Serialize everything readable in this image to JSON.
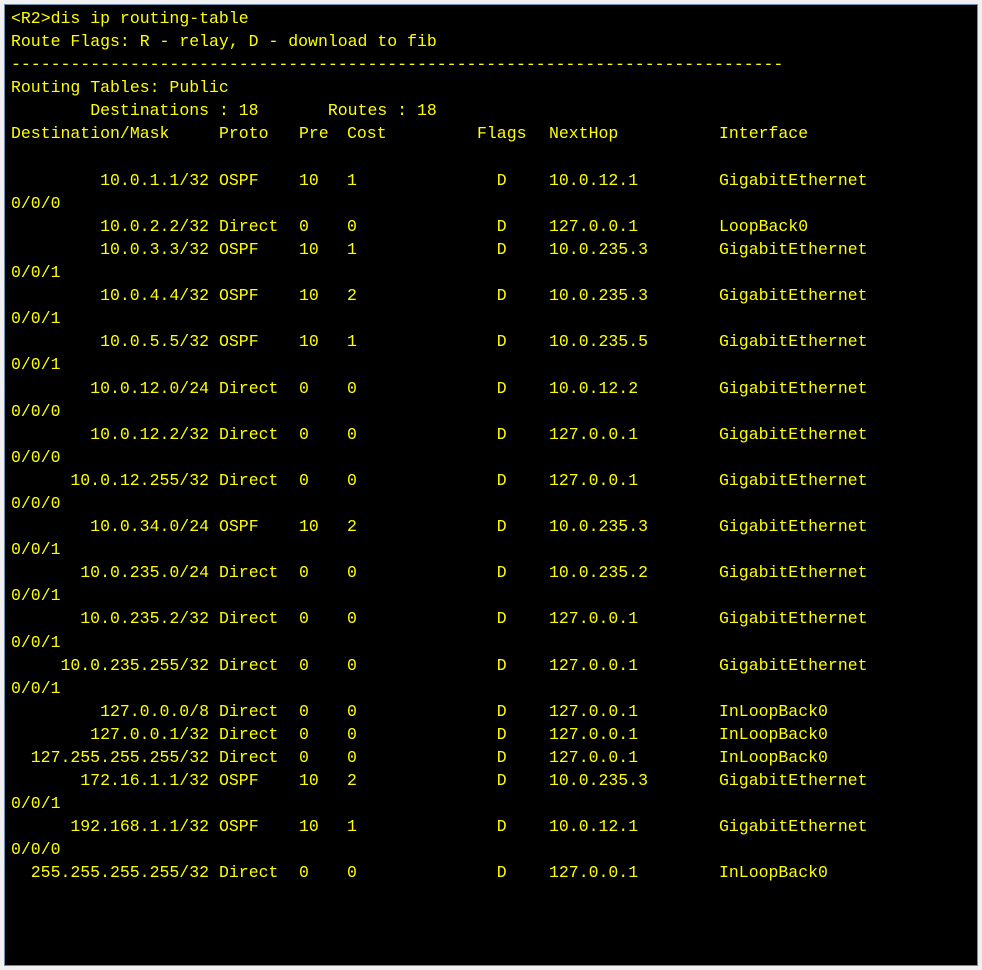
{
  "cli": {
    "prompt": "<R2>",
    "command": "dis ip routing-table",
    "flags_line": "Route Flags: R - relay, D - download to fib",
    "separator": "------------------------------------------------------------------------------",
    "table_title": "Routing Tables: Public",
    "dest_label": "Destinations : 18",
    "routes_label": "Routes : 18",
    "headers": {
      "dest": "Destination/Mask",
      "proto": "Proto",
      "pre": "Pre",
      "cost": "Cost",
      "flags": "Flags",
      "nexthop": "NextHop",
      "interface": "Interface"
    },
    "entries": [
      {
        "dest": "10.0.1.1/32",
        "proto": "OSPF",
        "pre": "10",
        "cost": "1",
        "flags": "D",
        "nh": "10.0.12.1",
        "iface": "GigabitEthernet",
        "wrap": "0/0/0"
      },
      {
        "dest": "10.0.2.2/32",
        "proto": "Direct",
        "pre": "0",
        "cost": "0",
        "flags": "D",
        "nh": "127.0.0.1",
        "iface": "LoopBack0",
        "wrap": ""
      },
      {
        "dest": "10.0.3.3/32",
        "proto": "OSPF",
        "pre": "10",
        "cost": "1",
        "flags": "D",
        "nh": "10.0.235.3",
        "iface": "GigabitEthernet",
        "wrap": "0/0/1"
      },
      {
        "dest": "10.0.4.4/32",
        "proto": "OSPF",
        "pre": "10",
        "cost": "2",
        "flags": "D",
        "nh": "10.0.235.3",
        "iface": "GigabitEthernet",
        "wrap": "0/0/1"
      },
      {
        "dest": "10.0.5.5/32",
        "proto": "OSPF",
        "pre": "10",
        "cost": "1",
        "flags": "D",
        "nh": "10.0.235.5",
        "iface": "GigabitEthernet",
        "wrap": "0/0/1"
      },
      {
        "dest": "10.0.12.0/24",
        "proto": "Direct",
        "pre": "0",
        "cost": "0",
        "flags": "D",
        "nh": "10.0.12.2",
        "iface": "GigabitEthernet",
        "wrap": "0/0/0"
      },
      {
        "dest": "10.0.12.2/32",
        "proto": "Direct",
        "pre": "0",
        "cost": "0",
        "flags": "D",
        "nh": "127.0.0.1",
        "iface": "GigabitEthernet",
        "wrap": "0/0/0"
      },
      {
        "dest": "10.0.12.255/32",
        "proto": "Direct",
        "pre": "0",
        "cost": "0",
        "flags": "D",
        "nh": "127.0.0.1",
        "iface": "GigabitEthernet",
        "wrap": "0/0/0"
      },
      {
        "dest": "10.0.34.0/24",
        "proto": "OSPF",
        "pre": "10",
        "cost": "2",
        "flags": "D",
        "nh": "10.0.235.3",
        "iface": "GigabitEthernet",
        "wrap": "0/0/1"
      },
      {
        "dest": "10.0.235.0/24",
        "proto": "Direct",
        "pre": "0",
        "cost": "0",
        "flags": "D",
        "nh": "10.0.235.2",
        "iface": "GigabitEthernet",
        "wrap": "0/0/1"
      },
      {
        "dest": "10.0.235.2/32",
        "proto": "Direct",
        "pre": "0",
        "cost": "0",
        "flags": "D",
        "nh": "127.0.0.1",
        "iface": "GigabitEthernet",
        "wrap": "0/0/1"
      },
      {
        "dest": "10.0.235.255/32",
        "proto": "Direct",
        "pre": "0",
        "cost": "0",
        "flags": "D",
        "nh": "127.0.0.1",
        "iface": "GigabitEthernet",
        "wrap": "0/0/1"
      },
      {
        "dest": "127.0.0.0/8",
        "proto": "Direct",
        "pre": "0",
        "cost": "0",
        "flags": "D",
        "nh": "127.0.0.1",
        "iface": "InLoopBack0",
        "wrap": ""
      },
      {
        "dest": "127.0.0.1/32",
        "proto": "Direct",
        "pre": "0",
        "cost": "0",
        "flags": "D",
        "nh": "127.0.0.1",
        "iface": "InLoopBack0",
        "wrap": ""
      },
      {
        "dest": "127.255.255.255/32",
        "proto": "Direct",
        "pre": "0",
        "cost": "0",
        "flags": "D",
        "nh": "127.0.0.1",
        "iface": "InLoopBack0",
        "wrap": ""
      },
      {
        "dest": "172.16.1.1/32",
        "proto": "OSPF",
        "pre": "10",
        "cost": "2",
        "flags": "D",
        "nh": "10.0.235.3",
        "iface": "GigabitEthernet",
        "wrap": "0/0/1"
      },
      {
        "dest": "192.168.1.1/32",
        "proto": "OSPF",
        "pre": "10",
        "cost": "1",
        "flags": "D",
        "nh": "10.0.12.1",
        "iface": "GigabitEthernet",
        "wrap": "0/0/0"
      },
      {
        "dest": "255.255.255.255/32",
        "proto": "Direct",
        "pre": "0",
        "cost": "0",
        "flags": "D",
        "nh": "127.0.0.1",
        "iface": "InLoopBack0",
        "wrap": ""
      }
    ]
  }
}
